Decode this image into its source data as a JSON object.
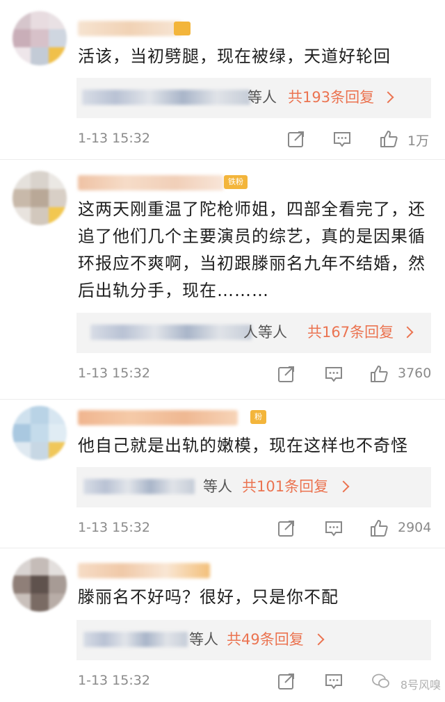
{
  "comments": [
    {
      "text": "活该，当初劈腿，现在被绿，天道好轮回",
      "badge": "",
      "reply_suffix": "等人",
      "reply_count": "共193条回复",
      "time": "1-13 15:32",
      "likes": "1万"
    },
    {
      "text": "这两天刚重温了陀枪师姐，四部全看完了，还追了他们几个主要演员的综艺，真的是因果循环报应不爽啊，当初跟滕丽名九年不结婚，然后出轨分手，现在………",
      "badge": "铁粉",
      "reply_suffix": "人等人",
      "reply_count": "共167条回复",
      "time": "1-13 15:32",
      "likes": "3760"
    },
    {
      "text": "他自己就是出轨的嫩模，现在这样也不奇怪",
      "badge": "粉",
      "reply_suffix": "等人",
      "reply_count": "共101条回复",
      "time": "1-13 15:32",
      "likes": "2904"
    },
    {
      "text": "滕丽名不好吗？很好，只是你不配",
      "badge": "",
      "reply_suffix": "等人",
      "reply_count": "共49条回复",
      "time": "1-13 15:32",
      "likes": ""
    }
  ],
  "icons": {
    "repost": "repost-icon",
    "comment": "comment-icon",
    "like": "thumbs-up-icon"
  },
  "colors": {
    "accent": "#eb7350",
    "badge": "#f3b53b",
    "meta": "#8a8a8a"
  },
  "watermark": "8号风嗅"
}
